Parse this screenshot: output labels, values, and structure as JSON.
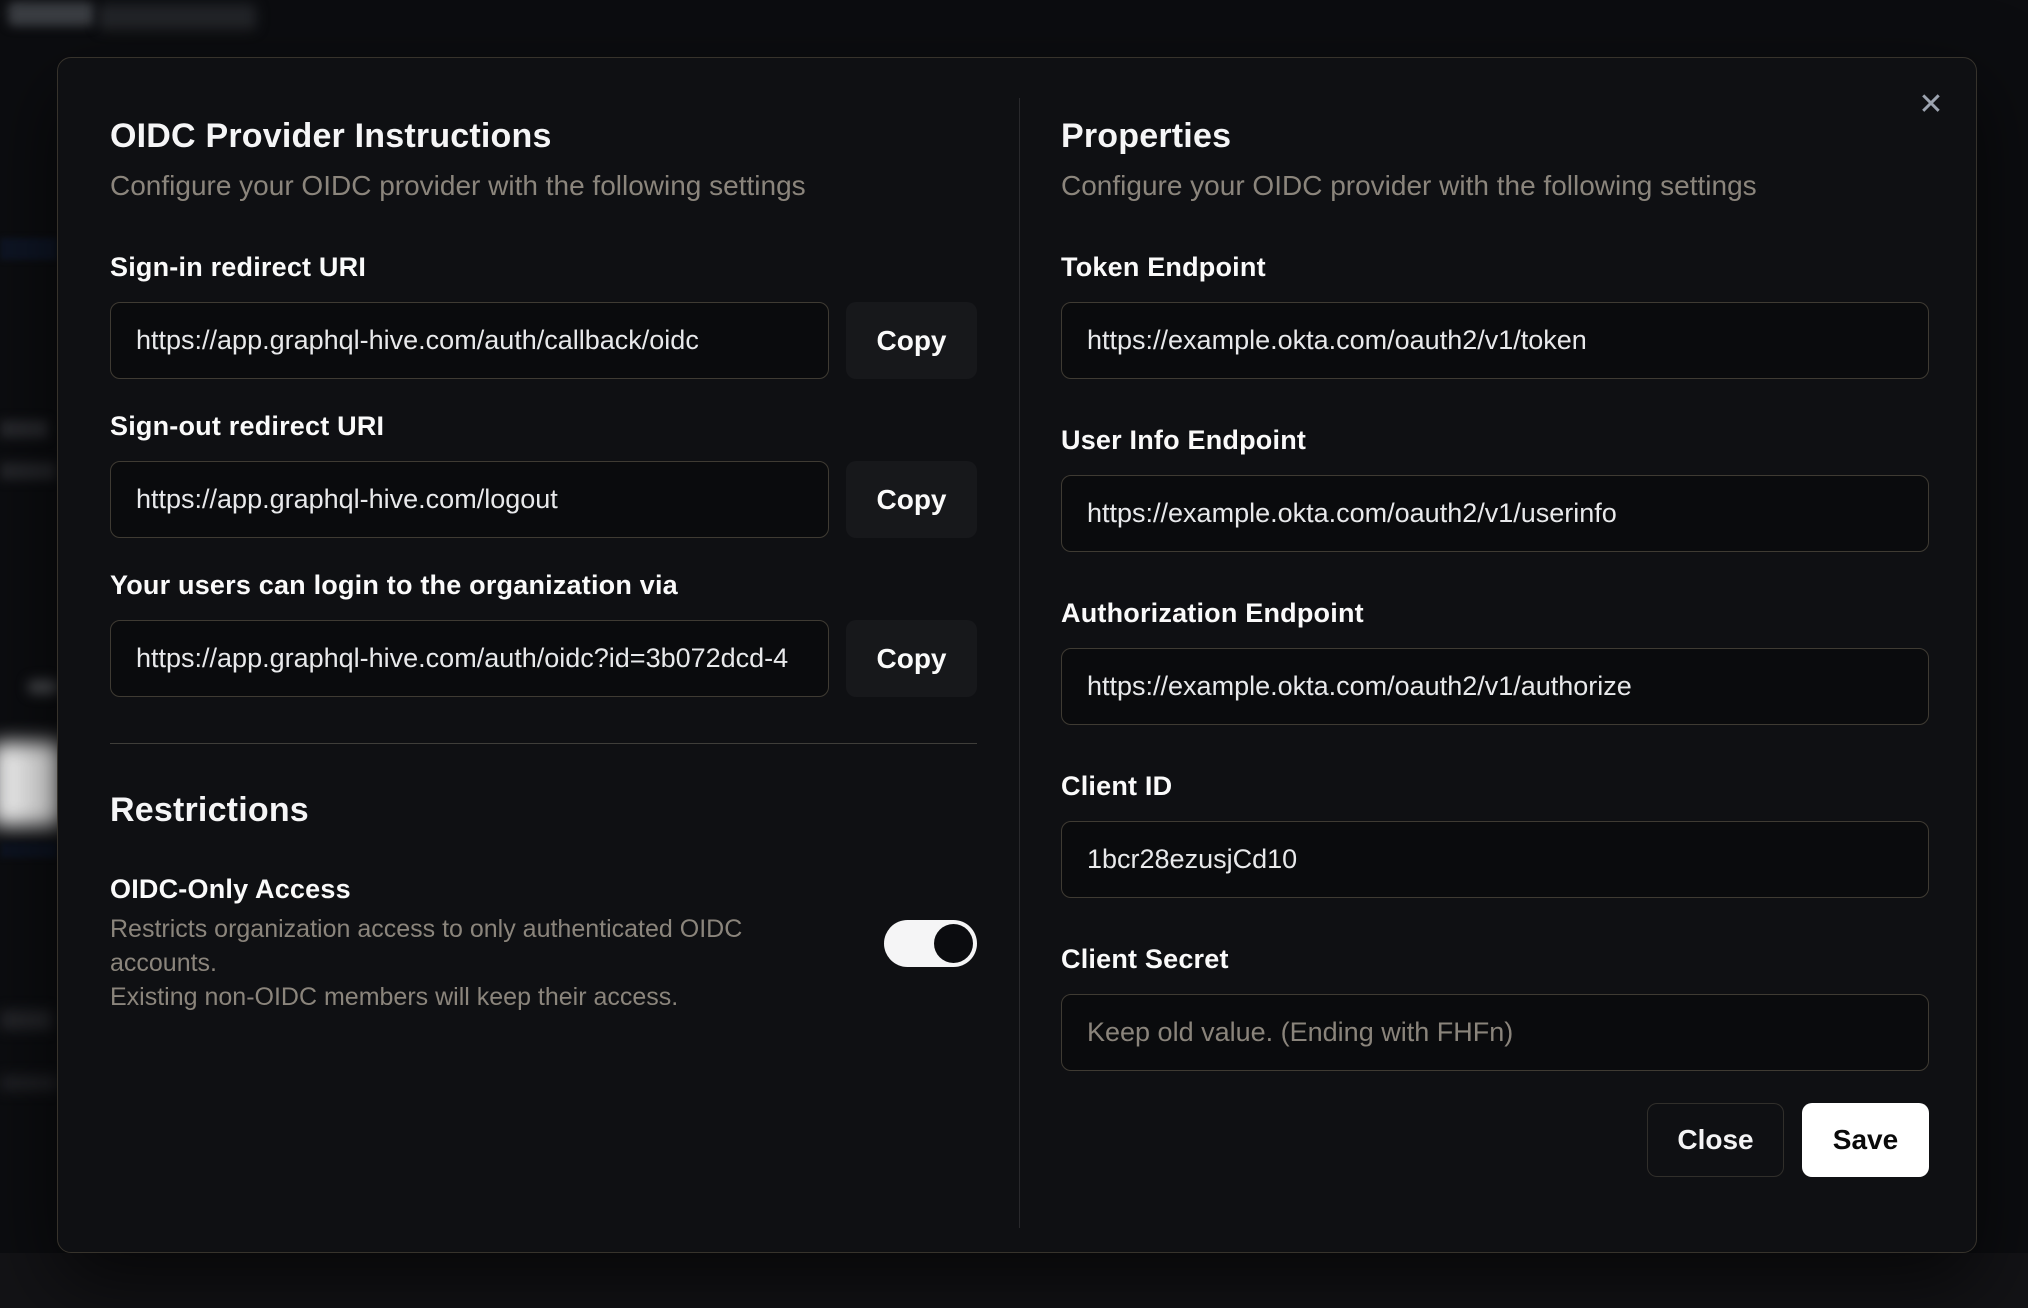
{
  "modal": {
    "close_icon": "✕",
    "left": {
      "title": "OIDC Provider Instructions",
      "subtitle": "Configure your OIDC provider with the following settings",
      "fields": [
        {
          "label": "Sign-in redirect URI",
          "value": "https://app.graphql-hive.com/auth/callback/oidc",
          "copy_label": "Copy"
        },
        {
          "label": "Sign-out redirect URI",
          "value": "https://app.graphql-hive.com/logout",
          "copy_label": "Copy"
        },
        {
          "label": "Your users can login to the organization via",
          "value": "https://app.graphql-hive.com/auth/oidc?id=3b072dcd-4",
          "copy_label": "Copy"
        }
      ],
      "restrictions": {
        "title": "Restrictions",
        "toggle_label": "OIDC-Only Access",
        "description_line1": "Restricts organization access to only authenticated OIDC accounts.",
        "description_line2": "Existing non-OIDC members will keep their access.",
        "toggle_on": true
      }
    },
    "right": {
      "title": "Properties",
      "subtitle": "Configure your OIDC provider with the following settings",
      "fields": [
        {
          "label": "Token Endpoint",
          "value": "https://example.okta.com/oauth2/v1/token"
        },
        {
          "label": "User Info Endpoint",
          "value": "https://example.okta.com/oauth2/v1/userinfo"
        },
        {
          "label": "Authorization Endpoint",
          "value": "https://example.okta.com/oauth2/v1/authorize"
        },
        {
          "label": "Client ID",
          "value": "1bcr28ezusjCd10"
        },
        {
          "label": "Client Secret",
          "value": "",
          "placeholder": "Keep old value. (Ending with FHFn)"
        }
      ],
      "buttons": {
        "close": "Close",
        "save": "Save"
      }
    }
  },
  "colors": {
    "modal_background": "#0f1013",
    "input_border": "#3f3b33",
    "muted_text": "#8b857c",
    "save_button_background": "#ffffff",
    "toggle_on_track": "#f5f5f6"
  }
}
